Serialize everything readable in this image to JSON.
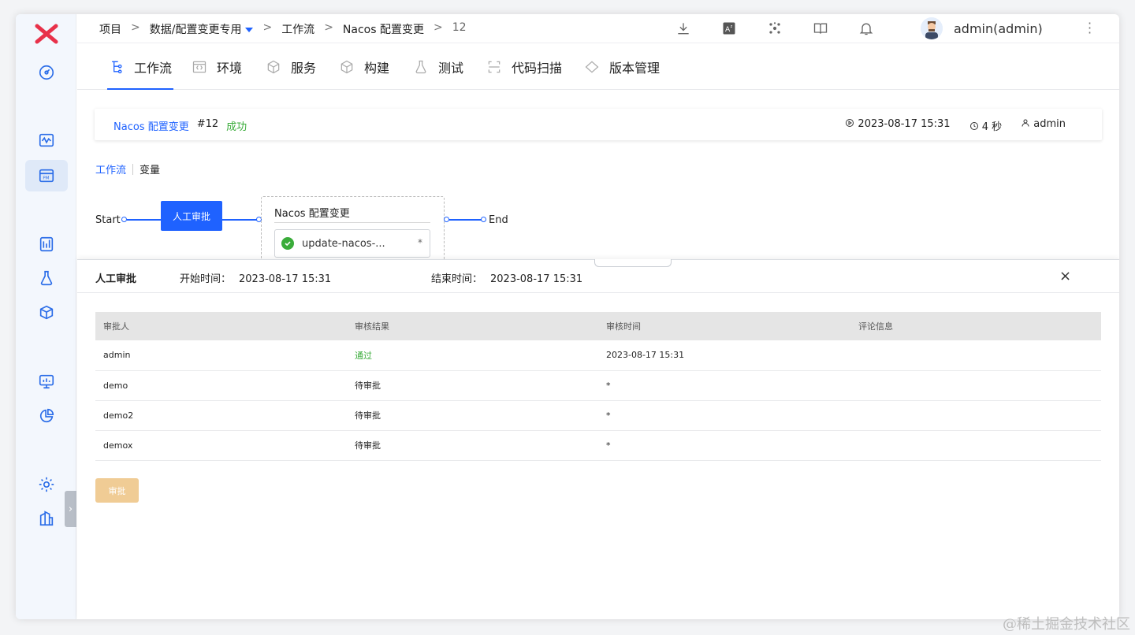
{
  "breadcrumb": {
    "items": [
      "项目",
      "数据/配置变更专用",
      "工作流",
      "Nacos 配置变更",
      "12"
    ],
    "separator": ">"
  },
  "header": {
    "user_name": "admin(admin)",
    "icons": [
      "download-icon",
      "translate-icon",
      "plugins-icon",
      "docs-icon",
      "bell-icon"
    ]
  },
  "tabs": [
    {
      "label": "工作流",
      "icon": "workflow-icon"
    },
    {
      "label": "环境",
      "icon": "env-icon"
    },
    {
      "label": "服务",
      "icon": "service-icon"
    },
    {
      "label": "构建",
      "icon": "build-icon"
    },
    {
      "label": "测试",
      "icon": "test-icon"
    },
    {
      "label": "代码扫描",
      "icon": "scan-icon"
    },
    {
      "label": "版本管理",
      "icon": "version-icon"
    }
  ],
  "run": {
    "name": "Nacos 配置变更",
    "number": "#12",
    "status": "成功",
    "start": "2023-08-17 15:31",
    "duration": "4 秒",
    "user": "admin"
  },
  "subtabs": {
    "workflow": "工作流",
    "vars": "变量"
  },
  "flow": {
    "start": "Start",
    "end": "End",
    "approval_node": "人工审批",
    "stage_title": "Nacos 配置变更",
    "job_name": "update-nacos-...",
    "job_mark": "*"
  },
  "drawer": {
    "title": "人工审批",
    "start_label": "开始时间：",
    "start_value": "2023-08-17 15:31",
    "end_label": "结束时间：",
    "end_value": "2023-08-17 15:31",
    "close": "×",
    "columns": [
      "审批人",
      "审核结果",
      "审核时间",
      "评论信息"
    ],
    "rows": [
      [
        "admin",
        "通过",
        "2023-08-17 15:31",
        ""
      ],
      [
        "demo",
        "待审批",
        "*",
        ""
      ],
      [
        "demo2",
        "待审批",
        "*",
        ""
      ],
      [
        "demox",
        "待审批",
        "*",
        ""
      ]
    ],
    "approve_button": "审批"
  },
  "colors": {
    "primary": "#1f62ff",
    "success": "#3aac3a",
    "approve_btn": "#f0cc95"
  },
  "watermark": "@稀土掘金技术社区"
}
